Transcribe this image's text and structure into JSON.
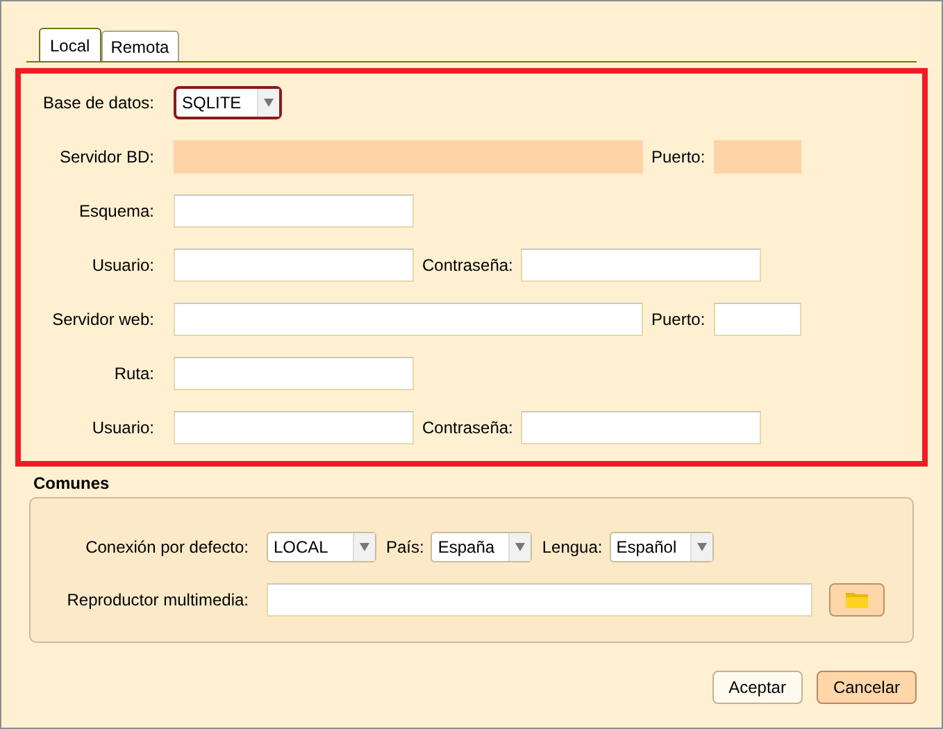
{
  "tabs": [
    {
      "label": "Local",
      "selected": true
    },
    {
      "label": "Remota",
      "selected": false
    }
  ],
  "local_rows": [
    {
      "fields": [
        {
          "label": "Base de datos:",
          "kind": "select",
          "value": "SQLITE"
        }
      ]
    },
    {
      "fields": [
        {
          "label": "Servidor BD:",
          "kind": "text",
          "disabled": true
        },
        {
          "label": "Puerto:",
          "kind": "text",
          "disabled": true
        }
      ]
    },
    {
      "fields": [
        {
          "label": "Esquema:",
          "kind": "text"
        }
      ]
    },
    {
      "fields": [
        {
          "label": "Usuario:",
          "kind": "text"
        },
        {
          "label": "Contraseña:",
          "kind": "text"
        }
      ]
    },
    {
      "fields": [
        {
          "label": "Servidor web:",
          "kind": "text"
        },
        {
          "label": "Puerto:",
          "kind": "text"
        }
      ]
    },
    {
      "fields": [
        {
          "label": "Ruta:",
          "kind": "text"
        }
      ]
    },
    {
      "fields": [
        {
          "label": "Usuario:",
          "kind": "text"
        },
        {
          "label": "Contraseña:",
          "kind": "text"
        }
      ]
    }
  ],
  "common": {
    "title": "Comunes",
    "rows": [
      {
        "fields": [
          {
            "label": "Conexión por defecto:",
            "kind": "select",
            "value": "LOCAL"
          },
          {
            "label": "País:",
            "kind": "select",
            "value": "España"
          },
          {
            "label": "Lengua:",
            "kind": "select",
            "value": "Español"
          }
        ]
      },
      {
        "fields": [
          {
            "label": "Reproductor multimedia:",
            "kind": "text"
          },
          {
            "kind": "folder_button"
          }
        ]
      }
    ]
  },
  "buttons": [
    {
      "label": "Aceptar",
      "kind": "default"
    },
    {
      "label": "Cancelar",
      "kind": "cancel"
    }
  ]
}
